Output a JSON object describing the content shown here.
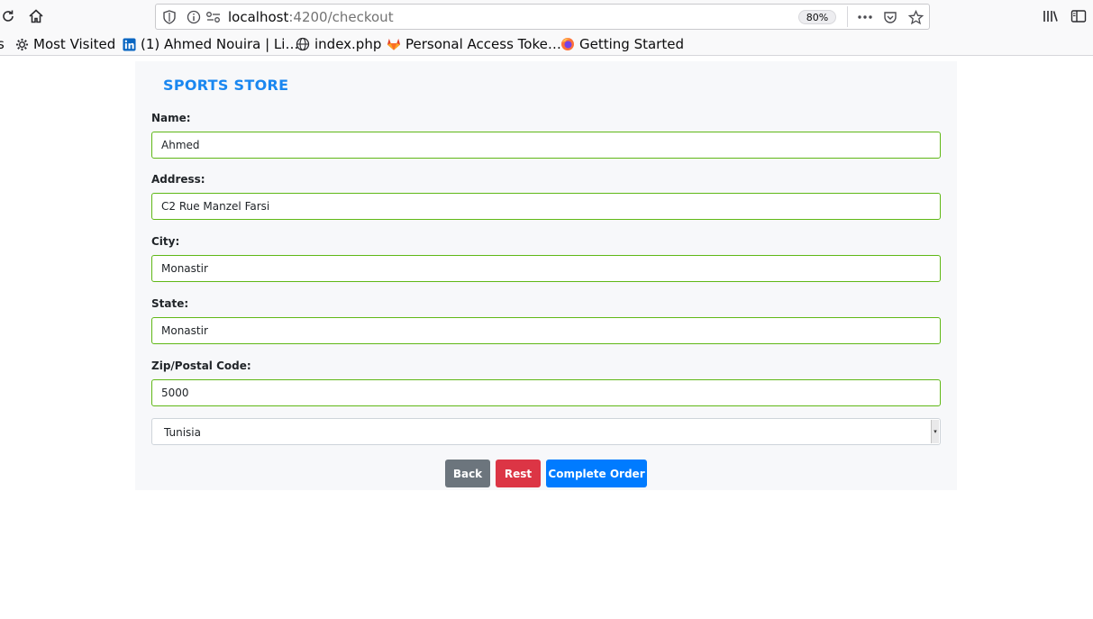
{
  "browser": {
    "url_host": "localhost",
    "url_path": ":4200/checkout",
    "zoom": "80%",
    "bookmarks": [
      {
        "label": "s"
      },
      {
        "label": "Most Visited",
        "icon": "gear-icon"
      },
      {
        "label": "(1) Ahmed Nouira | Li…",
        "icon": "linkedin-icon"
      },
      {
        "label": "index.php",
        "icon": "globe-icon"
      },
      {
        "label": "Personal Access Toke…",
        "icon": "gitlab-icon"
      },
      {
        "label": "Getting Started",
        "icon": "firefox-icon"
      }
    ]
  },
  "page": {
    "brand": "SPORTS STORE",
    "form": {
      "name_label": "Name:",
      "name_value": "Ahmed",
      "address_label": "Address:",
      "address_value": "C2 Rue Manzel Farsi",
      "city_label": "City:",
      "city_value": "Monastir",
      "state_label": "State:",
      "state_value": "Monastir",
      "zip_label": "Zip/Postal Code:",
      "zip_value": "5000",
      "country_value": "Tunisia"
    },
    "buttons": {
      "back": "Back",
      "reset": "Rest",
      "complete": "Complete Order"
    }
  },
  "colors": {
    "brand": "#1a87f0",
    "valid_border": "#5fb816",
    "back": "#6c757d",
    "reset": "#dc3545",
    "complete": "#007bff"
  }
}
